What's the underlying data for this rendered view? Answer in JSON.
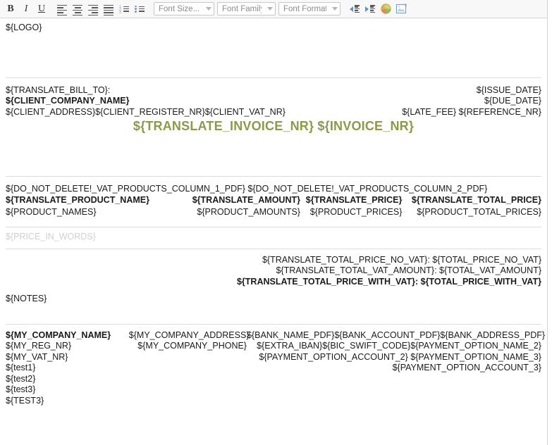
{
  "toolbar": {
    "bold_label": "B",
    "italic_label": "I",
    "underline_label": "U",
    "align_left_name": "align-left",
    "align_center_name": "align-center",
    "align_right_name": "align-right",
    "align_justify_name": "align-justify",
    "numbered_list_name": "numbered-list",
    "bulleted_list_name": "bulleted-list",
    "font_size_label": "Font Size...",
    "font_family_label": "Font Family.",
    "font_format_label": "Font Format",
    "indent_increase_name": "increase-indent",
    "indent_decrease_name": "decrease-indent",
    "text_color_name": "text-color",
    "image_name": "insert-image"
  },
  "document": {
    "logo": "${LOGO}",
    "bill_to_label": "${TRANSLATE_BILL_TO}:",
    "client_company_name": "${CLIENT_COMPANY_NAME}",
    "client_address": "${CLIENT_ADDRESS}",
    "client_register_nr": "${CLIENT_REGISTER_NR}",
    "client_vat_nr": "${CLIENT_VAT_NR}",
    "issue_date": "${ISSUE_DATE}",
    "due_date": "${DUE_DATE}",
    "late_fee": "${LATE_FEE}",
    "reference_nr": "${REFERENCE_NR}",
    "invoice_title_translate": "${TRANSLATE_INVOICE_NR}",
    "invoice_title_number": "${INVOICE_NR}",
    "products_column_1_pdf": "${DO_NOT_DELETE!_VAT_PRODUCTS_COLUMN_1_PDF}",
    "products_column_2_pdf": "${DO_NOT_DELETE!_VAT_PRODUCTS_COLUMN_2_PDF}",
    "header_product_name": "${TRANSLATE_PRODUCT_NAME}",
    "header_amount": "${TRANSLATE_AMOUNT}",
    "header_price": "${TRANSLATE_PRICE}",
    "header_total_price": "${TRANSLATE_TOTAL_PRICE}",
    "product_names": "${PRODUCT_NAMES}",
    "product_amounts": "${PRODUCT_AMOUNTS}",
    "product_prices": "${PRODUCT_PRICES}",
    "product_total_prices": "${PRODUCT_TOTAL_PRICES}",
    "price_in_words": "${PRICE_IN_WORDS}",
    "total_no_vat_label": "${TRANSLATE_TOTAL_PRICE_NO_VAT}:",
    "total_no_vat_value": "${TOTAL_PRICE_NO_VAT}",
    "total_vat_amount_label": "${TRANSLATE_TOTAL_VAT_AMOUNT}:",
    "total_vat_amount_value": "${TOTAL_VAT_AMOUNT}",
    "total_with_vat_label": "${TRANSLATE_TOTAL_PRICE_WITH_VAT}:",
    "total_with_vat_value": "${TOTAL_PRICE_WITH_VAT}",
    "notes": "${NOTES}",
    "my_company_name": "${MY_COMPANY_NAME}",
    "my_reg_nr": "${MY_REG_NR}",
    "my_vat_nr": "${MY_VAT_NR}",
    "test1": "${test1}",
    "test2": "${test2}",
    "test3": "${test3}",
    "TEST3": "${TEST3}",
    "my_company_address": "${MY_COMPANY_ADDRESS}",
    "my_company_phone": "${MY_COMPANY_PHONE}",
    "bank_name_pdf": "${BANK_NAME_PDF}",
    "bank_account_pdf": "${BANK_ACCOUNT_PDF}",
    "bank_address_pdf": "${BANK_ADDRESS_PDF}",
    "extra_iban": "${EXTRA_IBAN}",
    "bic_swift_code": "${BIC_SWIFT_CODE}",
    "payment_option_name_2": "${PAYMENT_OPTION_NAME_2}",
    "payment_option_account_2": "${PAYMENT_OPTION_ACCOUNT_2}",
    "payment_option_name_3": "${PAYMENT_OPTION_NAME_3}",
    "payment_option_account_3": "${PAYMENT_OPTION_ACCOUNT_3}"
  },
  "colors": {
    "title_green": "#8a9a4b",
    "toolbar_bg": "#f8f8f8",
    "border": "#d4d4d4",
    "rule": "#dcdcdc",
    "muted_text": "#d0d0d0"
  }
}
